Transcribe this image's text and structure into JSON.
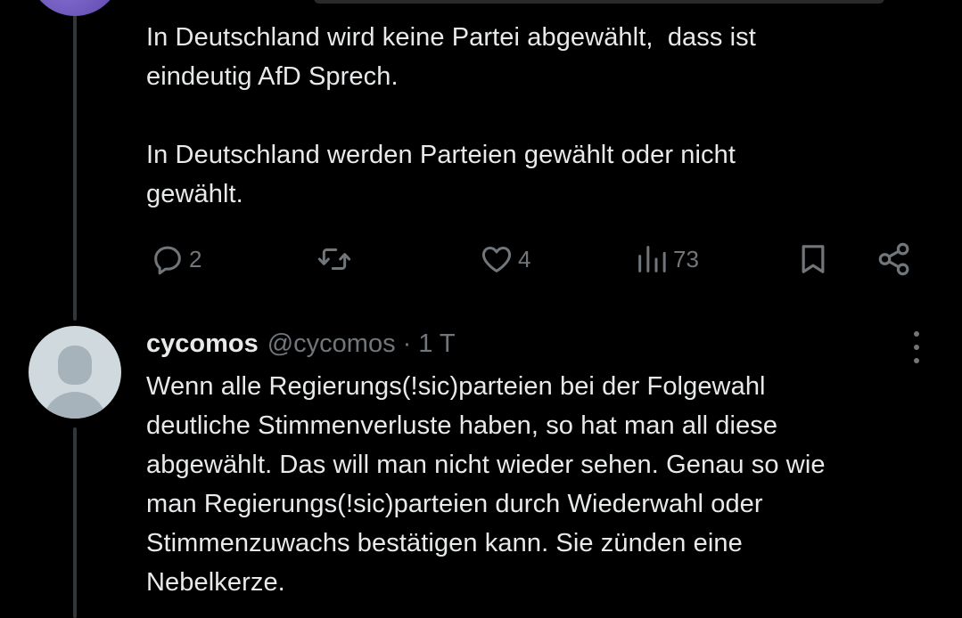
{
  "previous_tweet": {
    "text": "In Deutschland wird keine Partei abgewählt,  dass ist\neindeutig AfD Sprech.\n\nIn Deutschland werden Parteien gewählt oder nicht\ngewählt.",
    "actions": {
      "reply_icon": "reply-icon",
      "reply_count": "2",
      "retweet_icon": "retweet-icon",
      "like_icon": "heart-icon",
      "like_count": "4",
      "views_icon": "views-icon",
      "views_count": "73",
      "bookmark_icon": "bookmark-icon",
      "share_icon": "share-icon"
    }
  },
  "reply_tweet": {
    "display_name": "cycomos",
    "handle": "@cycomos",
    "separator": "·",
    "time": "1 T",
    "text": "Wenn alle Regierungs(!sic)parteien bei der Folgewahl\ndeutliche Stimmenverluste haben, so hat man all diese\nabgewählt. Das will man nicht wieder sehen. Genau so wie\nman Regierungs(!sic)parteien durch Wiederwahl oder\nStimmenzuwachs bestätigen kann. Sie zünden eine\nNebelkerze."
  },
  "colors": {
    "background": "#000000",
    "text": "#e7e9ea",
    "muted": "#71767b",
    "thread_line": "#333639"
  }
}
